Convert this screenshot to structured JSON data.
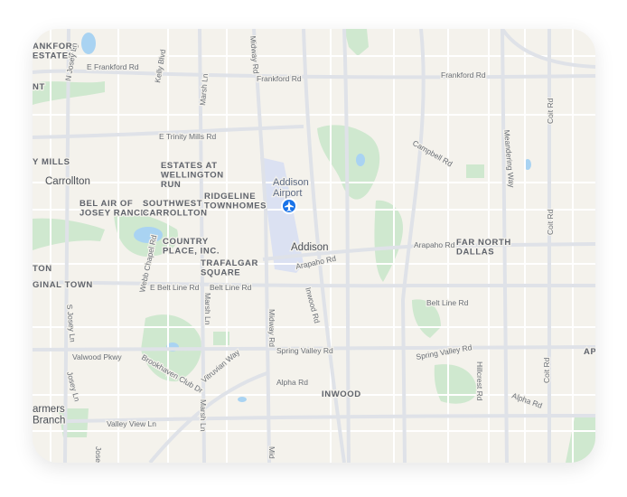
{
  "map": {
    "areas": {
      "frankford_estates": "ANKFORD\nESTATES",
      "nt": "NT",
      "josey_mills": "Y MILLS",
      "estates_at_wellington_run": "ESTATES AT\nWELLINGTON\nRUN",
      "bel_air_of_josey_ranch": "BEL AIR OF\nJOSEY RANCH",
      "southwest_carrollton": "SOUTHWEST\nCARROLLTON",
      "ridgeline_townhomes": "RIDGELINE\nTOWNHOMES",
      "country_place": "COUNTRY\nPLACE, INC.",
      "trafalgar_square": "TRAFALGAR\nSQUARE",
      "far_north_dallas": "FAR NORTH\nDALLAS",
      "ginal_town": "GINAL TOWN",
      "ton": "TON",
      "inwood": "INWOOD",
      "ap": "AP"
    },
    "cities": {
      "carrollton": "Carrollton",
      "addison": "Addison",
      "farmers_branch": "armers\nBranch"
    },
    "poi": {
      "addison_airport": "Addison\nAirport",
      "airport_pin_color": "#1a73e8"
    },
    "streets": {
      "e_frankford_rd": "E Frankford Rd",
      "frankford_rd_mid": "Frankford Rd",
      "frankford_rd_east": "Frankford Rd",
      "n_josey_ln": "N Josey Ln",
      "kelly_blvd": "Kelly Blvd",
      "marsh_ln_north": "Marsh Ln",
      "midway_rd_north": "Midway Rd",
      "e_trinity_mills_rd": "E Trinity Mills Rd",
      "campbell_rd": "Campbell Rd",
      "meandering_way": "Meandering Way",
      "coit_rd_north": "Coit Rd",
      "coit_rd_mid": "Coit Rd",
      "coit_rd_south": "Coit Rd",
      "arapaho_rd_east": "Arapaho Rd",
      "arapaho_rd_mid": "Arapaho Rd",
      "e_belt_line_rd": "E Belt Line Rd",
      "belt_line_rd_mid": "Belt Line Rd",
      "belt_line_rd_east": "Belt Line Rd",
      "inwood_rd": "Inwood Rd",
      "webb_chapel_rd": "Webb Chapel Rd",
      "s_josey_ln": "S Josey Ln",
      "marsh_ln_south": "Marsh Ln",
      "midway_rd_south": "Midway Rd",
      "valwood_pkwy": "Valwood Pkwy",
      "brookhaven_club_dr": "Brookhaven Club Dr",
      "vitruvian_way": "Vitruvian Way",
      "spring_valley_rd_mid": "Spring Valley Rd",
      "spring_valley_rd_east": "Spring Valley Rd",
      "alpha_rd_mid": "Alpha Rd",
      "alpha_rd_east": "Alpha Rd",
      "hillcrest_rd": "Hillcrest Rd",
      "josey_ln_south": "Josey Ln",
      "valley_view_ln": "Valley View Ln",
      "marsh_ln_bottom": "Marsh Ln",
      "josey_bottom": "Jose",
      "mid_bottom": "Mid"
    },
    "colors": {
      "land": "#f4f2ec",
      "park": "#cfe8cf",
      "water": "#a9d3f2",
      "road": "#ffffff",
      "major_road": "#dfe2e8",
      "airport": "#dbe1f2"
    }
  }
}
